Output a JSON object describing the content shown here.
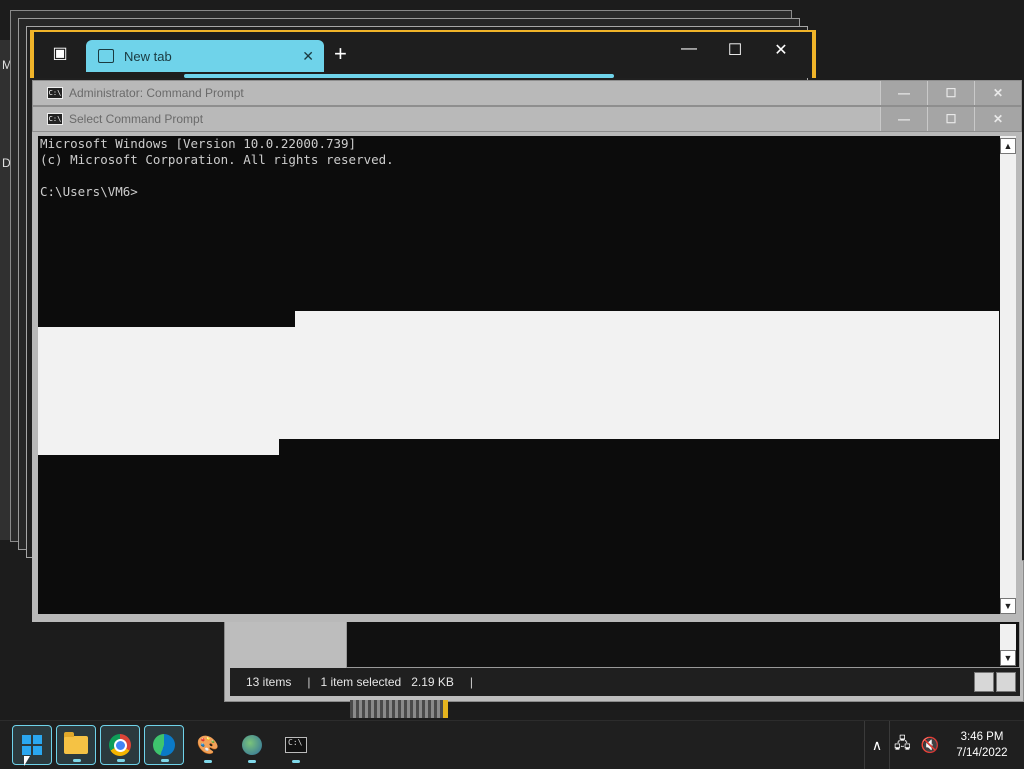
{
  "desktop": {
    "left_edge_letters": [
      "M",
      "D"
    ]
  },
  "browser": {
    "tab_label": "New tab",
    "tab_close": "✕",
    "new_tab": "+",
    "minimize": "—",
    "maximize": "☐",
    "close": "✕",
    "accent_color": "#6fd3ea",
    "frame_color": "#f0b429"
  },
  "cmd_windows": [
    {
      "title": "Administrator: Command Prompt",
      "minimize": "—",
      "maximize": "☐",
      "close": "✕"
    },
    {
      "title": "Select Command Prompt",
      "minimize": "—",
      "maximize": "☐",
      "close": "✕"
    }
  ],
  "console": {
    "lines": [
      "Microsoft Windows [Version 10.0.22000.739]",
      "(c) Microsoft Corporation. All rights reserved.",
      "",
      "C:\\Users\\VM6>"
    ]
  },
  "explorer": {
    "items_count": "13 items",
    "selected": "1 item selected",
    "selected_size": "2.19 KB",
    "separator": "|"
  },
  "taskbar": {
    "apps": [
      {
        "name": "Start",
        "icon": "windows-icon",
        "active": true
      },
      {
        "name": "File Explorer",
        "icon": "folder-icon",
        "active": true
      },
      {
        "name": "Google Chrome",
        "icon": "chrome-icon",
        "active": true
      },
      {
        "name": "Microsoft Edge",
        "icon": "edge-icon",
        "active": true
      },
      {
        "name": "Paint",
        "icon": "palette-icon",
        "active": false
      },
      {
        "name": "Network",
        "icon": "globe-icon",
        "active": false
      },
      {
        "name": "Command Prompt",
        "icon": "terminal-icon",
        "active": false
      }
    ],
    "tray_chevron": "∧",
    "network_icon": "🖧",
    "volume_icon": "🔇",
    "time": "3:46 PM",
    "date": "7/14/2022"
  }
}
